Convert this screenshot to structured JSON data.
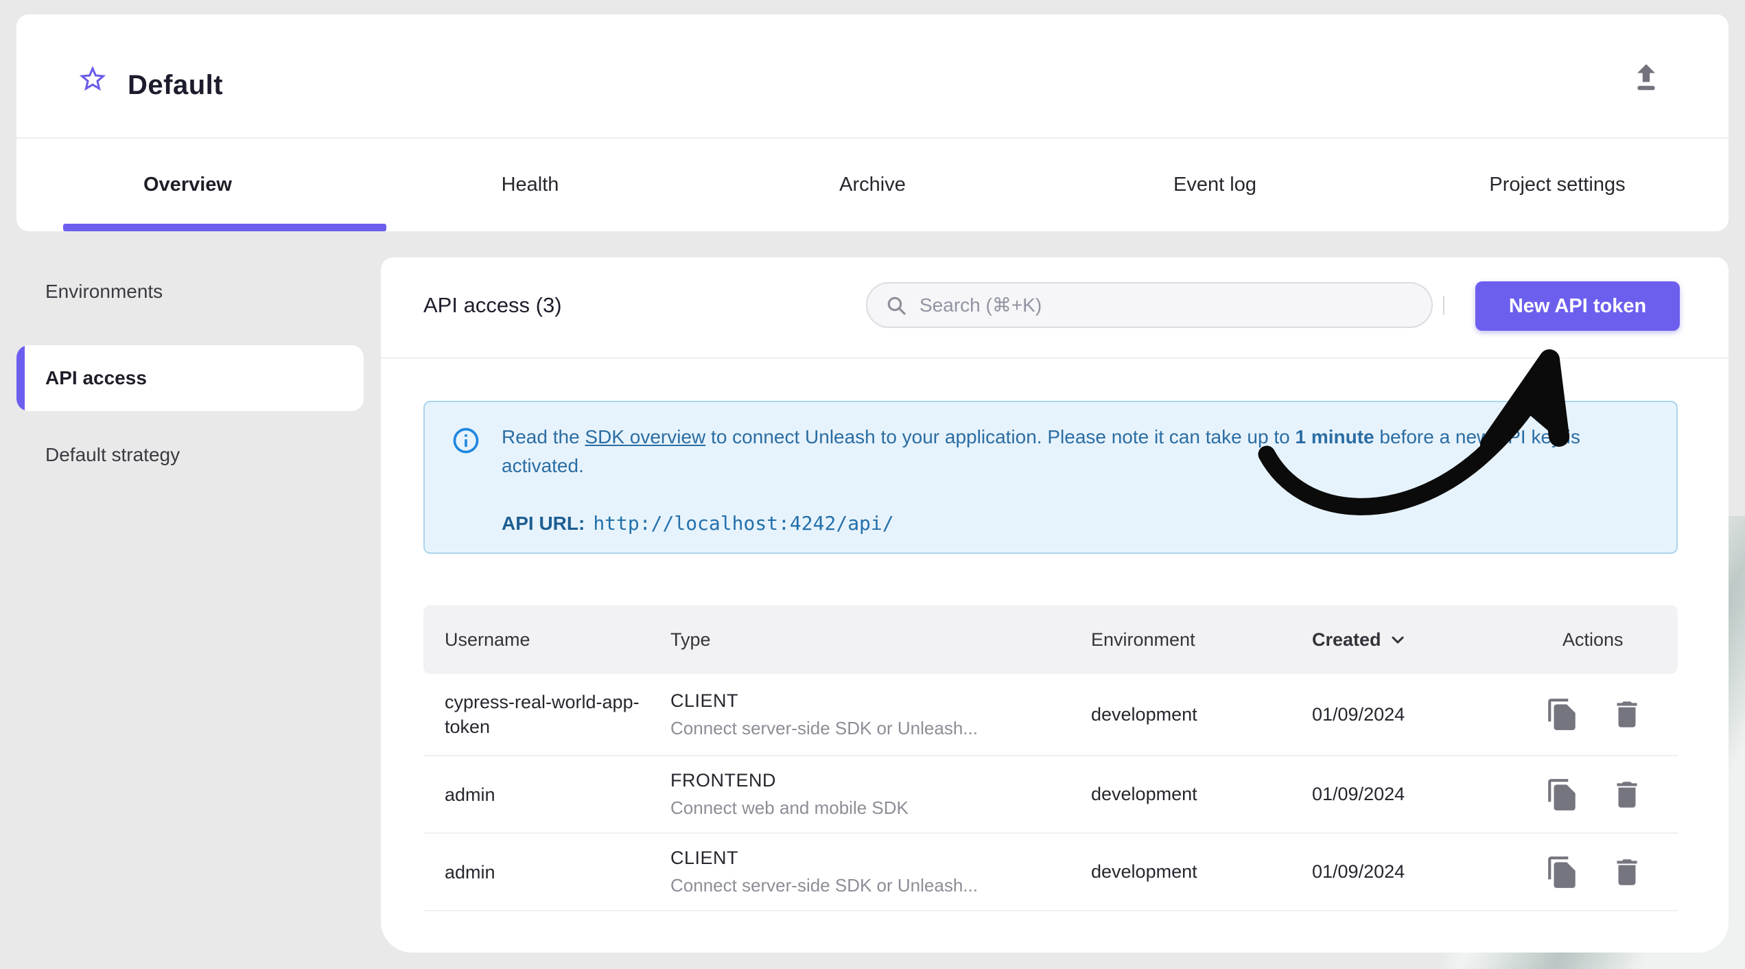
{
  "project": {
    "title": "Default"
  },
  "tabs": [
    {
      "label": "Overview",
      "active": true
    },
    {
      "label": "Health",
      "active": false
    },
    {
      "label": "Archive",
      "active": false
    },
    {
      "label": "Event log",
      "active": false
    },
    {
      "label": "Project settings",
      "active": false
    }
  ],
  "sidebar": {
    "items": [
      {
        "label": "Environments",
        "active": false
      },
      {
        "label": "API access",
        "active": true
      },
      {
        "label": "Default strategy",
        "active": false
      }
    ]
  },
  "main": {
    "title": "API access (3)",
    "search": {
      "placeholder": "Search (⌘+K)",
      "value": ""
    },
    "new_token_button": "New API token",
    "alert": {
      "text_before_link": "Read the ",
      "link_text": "SDK overview",
      "text_after_link": " to connect Unleash to your application. Please note it can take up to ",
      "bold_text": "1 minute",
      "text_end": " before a new API key is activated.",
      "api_url_label": "API URL:",
      "api_url_value": "http://localhost:4242/api/"
    },
    "table": {
      "headers": {
        "username": "Username",
        "type": "Type",
        "environment": "Environment",
        "created": "Created",
        "actions": "Actions"
      },
      "sorted_by": "Created",
      "rows": [
        {
          "username": "cypress-real-world-app-token",
          "type": "CLIENT",
          "type_desc": "Connect server-side SDK or Unleash...",
          "environment": "development",
          "created": "01/09/2024"
        },
        {
          "username": "admin",
          "type": "FRONTEND",
          "type_desc": "Connect web and mobile SDK",
          "environment": "development",
          "created": "01/09/2024"
        },
        {
          "username": "admin",
          "type": "CLIENT",
          "type_desc": "Connect server-side SDK or Unleash...",
          "environment": "development",
          "created": "01/09/2024"
        }
      ]
    }
  },
  "annotation": {
    "arrow_target": "new-api-token-button"
  },
  "colors": {
    "accent": "#6c5fee",
    "page_background": "#e9e9e9",
    "alert_background": "#e7f3fc",
    "alert_border": "#abd4ef",
    "alert_text": "#2b6da3",
    "alert_icon": "#1f87e0",
    "annotation_arrow": "#0b0b0b"
  }
}
